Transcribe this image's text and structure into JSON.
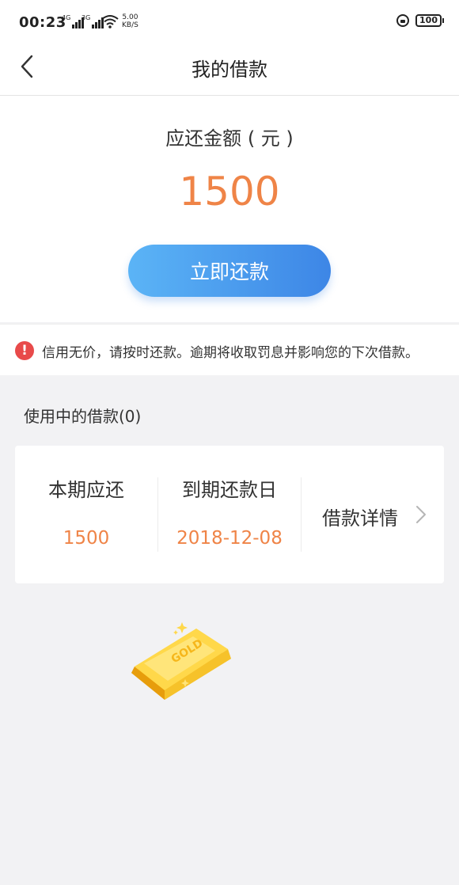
{
  "status_bar": {
    "time": "00:23",
    "signal1_tag": "4G",
    "signal2_tag": "3G",
    "speed_value": "5.00",
    "speed_unit": "KB/S",
    "battery": "100"
  },
  "nav": {
    "back_icon": "chevron-left-icon",
    "title": "我的借款"
  },
  "repayment": {
    "label": "应还金额 ( 元 )",
    "amount": "1500",
    "button_label": "立即还款",
    "button_gradient": [
      "#5bb4f6",
      "#3d86e6"
    ],
    "amount_color": "#ef8447"
  },
  "notice": {
    "icon": "exclamation-circle-icon",
    "icon_color": "#e84a4a",
    "text": "信用无价，请按时还款。逾期将收取罚息并影响您的下次借款。"
  },
  "active_loans": {
    "title": "使用中的借款(0)",
    "card": {
      "current_due_label": "本期应还",
      "current_due_value": "1500",
      "due_date_label": "到期还款日",
      "due_date_value": "2018-12-08",
      "detail_label": "借款详情",
      "detail_icon": "chevron-right-icon"
    }
  },
  "illustration": {
    "name": "gold-bar-icon",
    "text": "GOLD"
  }
}
